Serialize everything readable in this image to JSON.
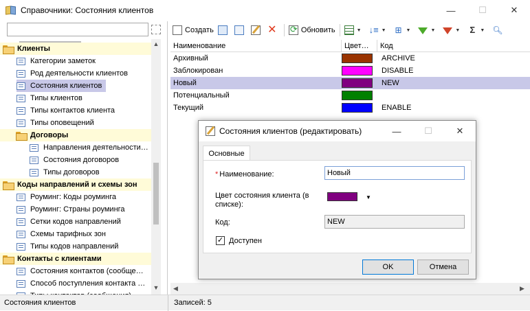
{
  "window": {
    "title": "Справочники: Состояния клиентов",
    "minimize": "—",
    "maximize": "☐",
    "close": "✕"
  },
  "sidebar": {
    "search_value": "",
    "tree": [
      {
        "label": "Клиенты",
        "kind": "group",
        "indent": 0
      },
      {
        "label": "Категории заметок",
        "kind": "item",
        "indent": 1
      },
      {
        "label": "Род деятельности клиентов",
        "kind": "item",
        "indent": 1
      },
      {
        "label": "Состояния клиентов",
        "kind": "item",
        "indent": 1,
        "selected": true
      },
      {
        "label": "Типы клиентов",
        "kind": "item",
        "indent": 1
      },
      {
        "label": "Типы контактов клиента",
        "kind": "item",
        "indent": 1
      },
      {
        "label": "Типы оповещений",
        "kind": "item",
        "indent": 1
      },
      {
        "label": "Договоры",
        "kind": "group",
        "indent": 1
      },
      {
        "label": "Направления деятельности…",
        "kind": "item",
        "indent": 2
      },
      {
        "label": "Состояния договоров",
        "kind": "item",
        "indent": 2
      },
      {
        "label": "Типы договоров",
        "kind": "item",
        "indent": 2
      },
      {
        "label": "Коды направлений и схемы зон",
        "kind": "group",
        "indent": 0
      },
      {
        "label": "Роуминг: Коды роуминга",
        "kind": "item",
        "indent": 1
      },
      {
        "label": "Роуминг: Страны роуминга",
        "kind": "item",
        "indent": 1
      },
      {
        "label": "Сетки кодов направлений",
        "kind": "item",
        "indent": 1
      },
      {
        "label": "Схемы тарифных зон",
        "kind": "item",
        "indent": 1
      },
      {
        "label": "Типы кодов направлений",
        "kind": "item",
        "indent": 1
      },
      {
        "label": "Контакты с клиентами",
        "kind": "group",
        "indent": 0
      },
      {
        "label": "Состояния контактов (сообще…",
        "kind": "item",
        "indent": 1
      },
      {
        "label": "Способ поступления контакта …",
        "kind": "item",
        "indent": 1
      },
      {
        "label": "Типы контактов (сообщения)",
        "kind": "item",
        "indent": 1
      }
    ]
  },
  "toolbar": {
    "create_label": "Создать",
    "refresh_label": "Обновить"
  },
  "grid": {
    "headers": {
      "name": "Наименование",
      "color": "Цвет…",
      "code": "Код"
    },
    "rows": [
      {
        "name": "Архивный",
        "color": "#993300",
        "code": "ARCHIVE",
        "selected": false
      },
      {
        "name": "Заблокирован",
        "color": "#ff00ff",
        "code": "DISABLE",
        "selected": false
      },
      {
        "name": "Новый",
        "color": "#800080",
        "code": "NEW",
        "selected": true
      },
      {
        "name": "Потенциальный",
        "color": "#008000",
        "code": "",
        "selected": false
      },
      {
        "name": "Текущий",
        "color": "#0000ff",
        "code": "ENABLE",
        "selected": false
      }
    ]
  },
  "statusbar": {
    "left": "Состояния клиентов",
    "right": "Записей: 5"
  },
  "dialog": {
    "title": "Состояния клиентов (редактировать)",
    "tab": "Основные",
    "name_label": "Наименование:",
    "required_mark": "*",
    "name_value": "Новый",
    "color_label": "Цвет состояния клиента (в списке):",
    "color_value": "#800080",
    "code_label": "Код:",
    "code_value": "NEW",
    "available_label": "Доступен",
    "available_checked": true,
    "ok_label": "OK",
    "cancel_label": "Отмена"
  }
}
